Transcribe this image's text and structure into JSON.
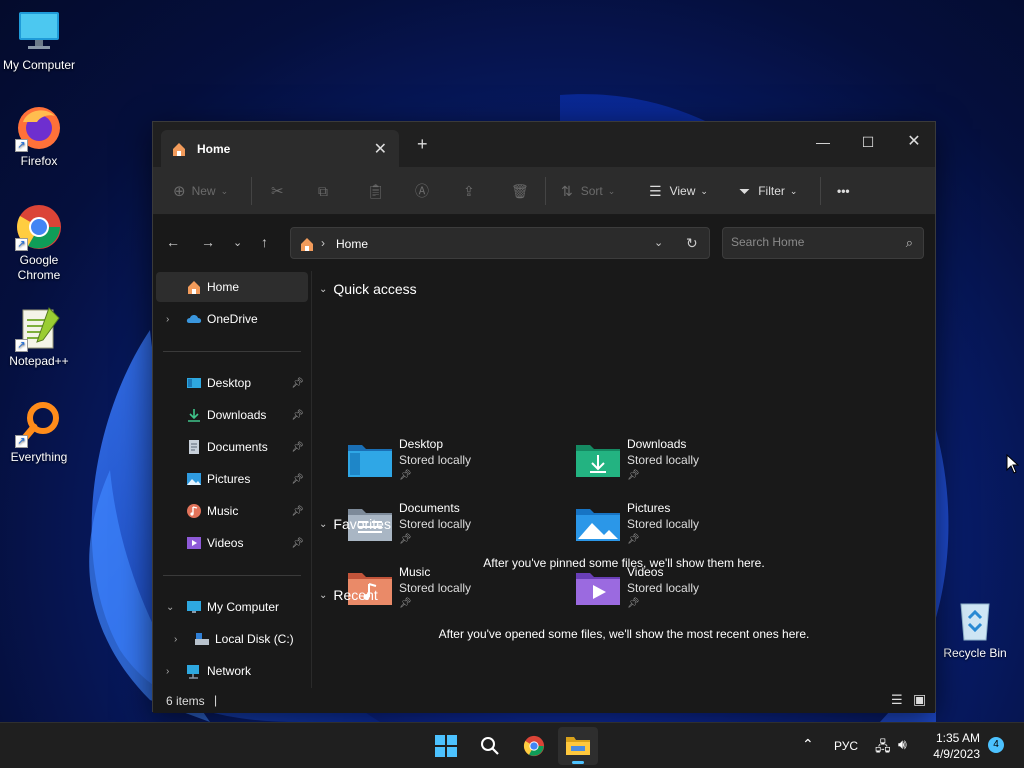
{
  "desktop": {
    "icons": [
      {
        "label": "My Computer"
      },
      {
        "label": "Firefox"
      },
      {
        "label": "Google Chrome"
      },
      {
        "label": "Notepad++"
      },
      {
        "label": "Everything"
      },
      {
        "label": "Recycle Bin"
      }
    ]
  },
  "window": {
    "tab_title": "Home",
    "toolbar": {
      "new_label": "New",
      "sort_label": "Sort",
      "view_label": "View",
      "filter_label": "Filter",
      "more_label": "•••"
    },
    "address": {
      "path": "Home"
    },
    "search": {
      "placeholder": "Search Home"
    },
    "sidebar": {
      "home": "Home",
      "onedrive": "OneDrive",
      "pinned": [
        {
          "label": "Desktop"
        },
        {
          "label": "Downloads"
        },
        {
          "label": "Documents"
        },
        {
          "label": "Pictures"
        },
        {
          "label": "Music"
        },
        {
          "label": "Videos"
        }
      ],
      "my_computer": "My Computer",
      "local_disk": "Local Disk (C:)",
      "network": "Network"
    },
    "content": {
      "quick_access_title": "Quick access",
      "tiles": [
        {
          "name": "Desktop",
          "sub": "Stored locally"
        },
        {
          "name": "Downloads",
          "sub": "Stored locally"
        },
        {
          "name": "Documents",
          "sub": "Stored locally"
        },
        {
          "name": "Pictures",
          "sub": "Stored locally"
        },
        {
          "name": "Music",
          "sub": "Stored locally"
        },
        {
          "name": "Videos",
          "sub": "Stored locally"
        }
      ],
      "favorites_title": "Favorites",
      "favorites_empty": "After you've pinned some files, we'll show them here.",
      "recent_title": "Recent",
      "recent_empty": "After you've opened some files, we'll show the most recent ones here."
    },
    "status": {
      "item_count": "6 items"
    }
  },
  "taskbar": {
    "language": "РУС",
    "time": "1:35 AM",
    "date": "4/9/2023",
    "notification_count": "4"
  },
  "colors": {
    "accent": "#4cc2ff",
    "window_bg": "#191919",
    "toolbar_bg": "#2c2c2c"
  }
}
